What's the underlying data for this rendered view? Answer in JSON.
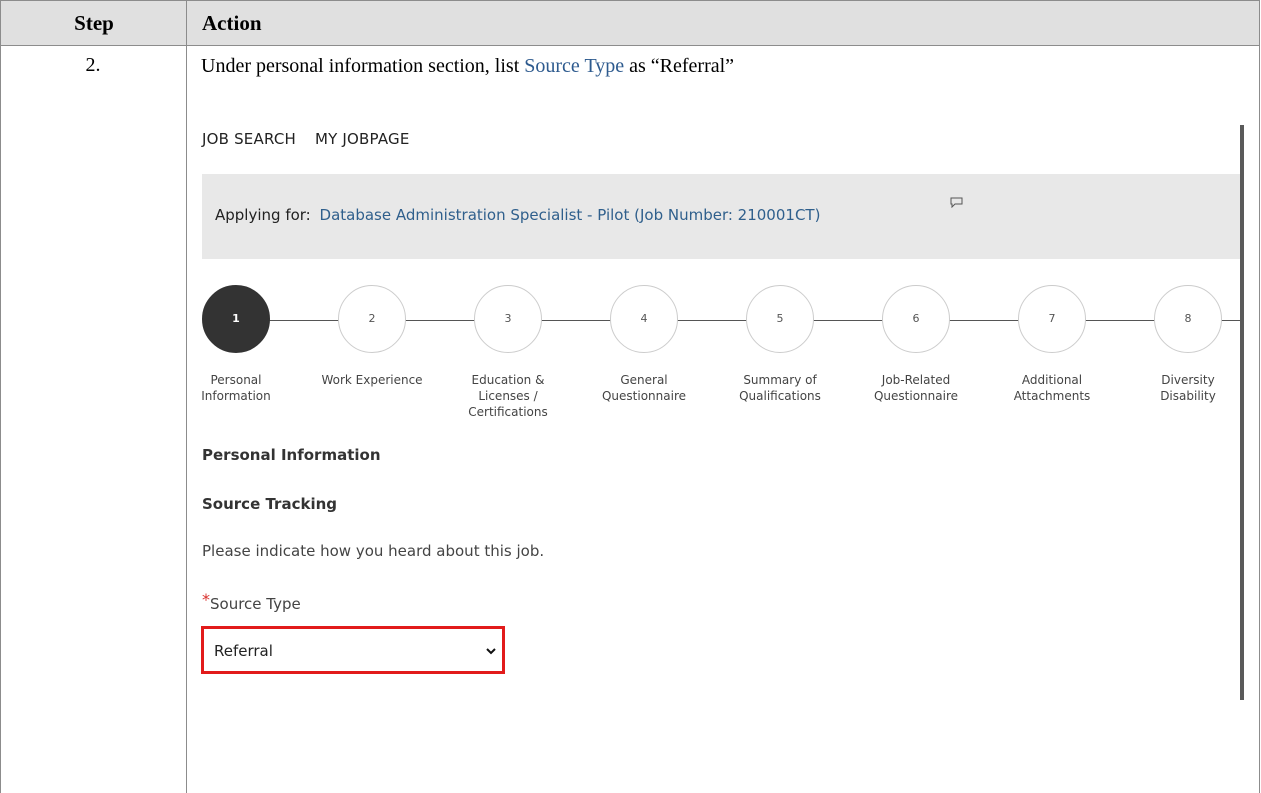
{
  "table": {
    "header_step": "Step",
    "header_action": "Action",
    "step_number": "2.",
    "instruction_pre": "Under personal information section, list ",
    "instruction_accent": "Source Type",
    "instruction_post": " as “Referral”"
  },
  "screenshot": {
    "nav": [
      "JOB SEARCH",
      "MY JOBPAGE"
    ],
    "applying_label": "Applying for:",
    "job_title": "Database Administration Specialist - Pilot (Job Number: 210001CT)",
    "steps": [
      {
        "num": "1",
        "label_lines": [
          "Personal",
          "Information"
        ],
        "active": true
      },
      {
        "num": "2",
        "label_lines": [
          "Work Experience"
        ],
        "active": false
      },
      {
        "num": "3",
        "label_lines": [
          "Education &",
          "Licenses /",
          "Certifications"
        ],
        "active": false
      },
      {
        "num": "4",
        "label_lines": [
          "General",
          "Questionnaire"
        ],
        "active": false
      },
      {
        "num": "5",
        "label_lines": [
          "Summary of",
          "Qualifications"
        ],
        "active": false
      },
      {
        "num": "6",
        "label_lines": [
          "Job-Related",
          "Questionnaire"
        ],
        "active": false
      },
      {
        "num": "7",
        "label_lines": [
          "Additional",
          "Attachments"
        ],
        "active": false
      },
      {
        "num": "8",
        "label_lines": [
          "Diversity",
          "Disability"
        ],
        "active": false
      }
    ],
    "section_title": "Personal Information",
    "subsection_title": "Source Tracking",
    "hint": "Please indicate how you heard about this job.",
    "required_mark": "*",
    "field_label": "Source Type",
    "selected_value": "Referral",
    "highlight_color": "#e21b1b",
    "link_color": "#2f5f8c"
  }
}
